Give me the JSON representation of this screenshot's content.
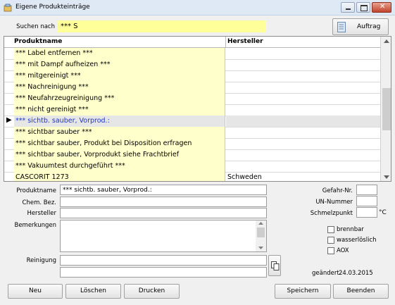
{
  "window": {
    "title": "Eigene Produkteinträge"
  },
  "search": {
    "label": "Suchen nach",
    "value": "*** S",
    "order_button": "Auftrag"
  },
  "grid": {
    "columns": [
      "Produktname",
      "Hersteller"
    ],
    "rows": [
      {
        "name": "*** Label entfernen ***",
        "maker": ""
      },
      {
        "name": "*** mit Dampf aufheizen ***",
        "maker": ""
      },
      {
        "name": "*** mitgereinigt ***",
        "maker": ""
      },
      {
        "name": "*** Nachreinigung ***",
        "maker": ""
      },
      {
        "name": "*** Neufahrzeugreinigung ***",
        "maker": ""
      },
      {
        "name": "*** nicht gereinigt ***",
        "maker": ""
      },
      {
        "name": "*** sichtb. sauber, Vorprod.:",
        "maker": ""
      },
      {
        "name": "*** sichtbar sauber ***",
        "maker": ""
      },
      {
        "name": "*** sichtbar sauber, Produkt bei Disposition erfragen",
        "maker": ""
      },
      {
        "name": "*** sichtbar sauber, Vorprodukt siehe Frachtbrief",
        "maker": ""
      },
      {
        "name": "*** Vakuumtest durchgeführt ***",
        "maker": ""
      },
      {
        "name": "CASCORIT 1273",
        "maker": "Schweden"
      }
    ],
    "selected_marker": "▶"
  },
  "form": {
    "produktname_label": "Produktname",
    "produktname_value": "*** sichtb. sauber, Vorprod.:",
    "chem_label": "Chem. Bez.",
    "chem_value": "",
    "hersteller_label": "Hersteller",
    "hersteller_value": "",
    "bemerkungen_label": "Bemerkungen",
    "bemerkungen_value": "",
    "reinigung_label": "Reinigung",
    "reinigung_value1": "",
    "reinigung_value2": "",
    "gefahr_label": "Gefahr-Nr.",
    "gefahr_value": "",
    "un_label": "UN-Nummer",
    "un_value": "",
    "schmelz_label": "Schmelzpunkt",
    "schmelz_value": "",
    "schmelz_unit": "°C",
    "cb_brennbar": "brennbar",
    "cb_wasserloeslich": "wasserlöslich",
    "cb_aox": "AOX",
    "geaendert_label": "geändert",
    "geaendert_value": "24.03.2015"
  },
  "buttons": {
    "neu": "Neu",
    "loeschen": "Löschen",
    "drucken": "Drucken",
    "speichern": "Speichern",
    "beenden": "Beenden"
  },
  "colors": {
    "search_bg": "#ffff99",
    "cell_bg": "#ffffcc",
    "selected_text": "#1c35c8"
  }
}
